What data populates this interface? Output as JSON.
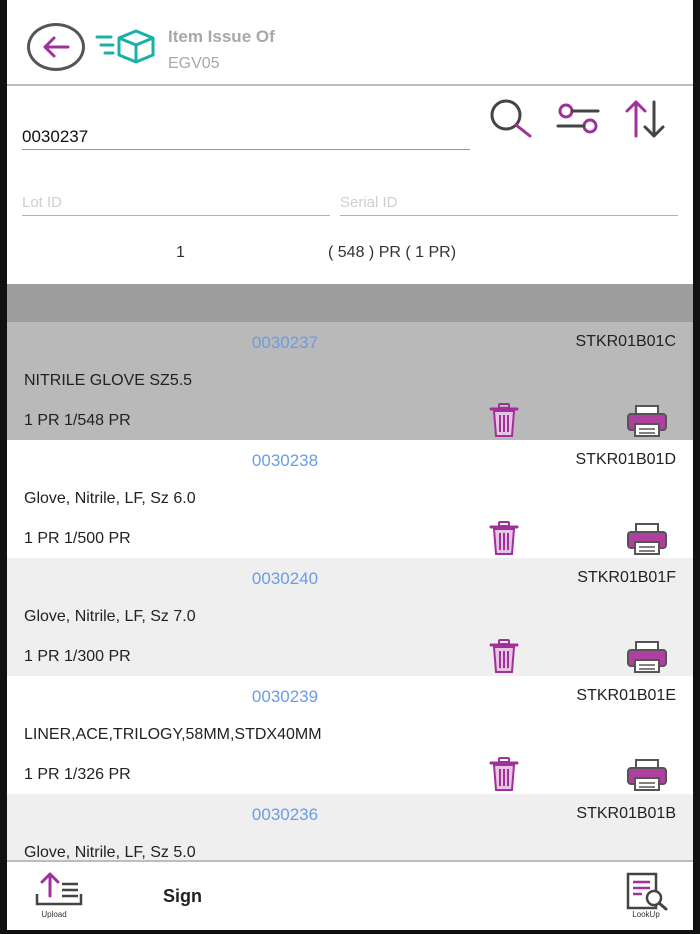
{
  "header": {
    "title_line1": "Item Issue Of",
    "title_line2": "EGV05"
  },
  "search": {
    "value": "0030237",
    "lot_placeholder": "Lot ID",
    "serial_placeholder": "Serial ID"
  },
  "summary": {
    "count": "1",
    "text": "( 548 )  PR ( 1 PR)"
  },
  "items": [
    {
      "id": "0030237",
      "location": "STKR01B01C",
      "description": "NITRILE GLOVE SZ5.5",
      "qty": "1 PR 1/548 PR"
    },
    {
      "id": "0030238",
      "location": "STKR01B01D",
      "description": "Glove, Nitrile, LF, Sz 6.0",
      "qty": "1 PR 1/500 PR"
    },
    {
      "id": "0030240",
      "location": "STKR01B01F",
      "description": "Glove, Nitrile, LF, Sz 7.0",
      "qty": "1 PR 1/300 PR"
    },
    {
      "id": "0030239",
      "location": "STKR01B01E",
      "description": "LINER,ACE,TRILOGY,58MM,STDX40MM",
      "qty": "1 PR 1/326 PR"
    },
    {
      "id": "0030236",
      "location": "STKR01B01B",
      "description": "Glove, Nitrile, LF, Sz 5.0",
      "qty": ""
    }
  ],
  "footer": {
    "upload_label": "Upload",
    "sign_label": "Sign",
    "lookup_label": "LookUp"
  },
  "colors": {
    "accent": "#a0309a",
    "teal": "#1ab0a8",
    "link": "#6b9ce8"
  }
}
